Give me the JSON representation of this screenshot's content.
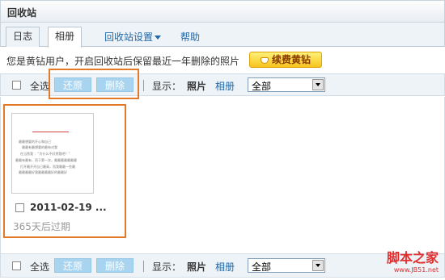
{
  "window": {
    "title": "回收站"
  },
  "tabs": [
    {
      "label": "日志",
      "active": false
    },
    {
      "label": "相册",
      "active": true
    }
  ],
  "nav": {
    "settings": "回收站设置",
    "help": "帮助"
  },
  "notice": "您是黄钻用户，开启回收站后保留最近一年删除的照片",
  "vip_button": "续费黄钻",
  "toolbar": {
    "select_all": "全选",
    "restore": "还原",
    "delete": "删除",
    "display_label": "显示：",
    "photos": "照片",
    "albums": "相册",
    "filter_value": "全部"
  },
  "item": {
    "name": "2011-02-19 ...",
    "expiry": "365天后过期",
    "thumb_lines": [
      "最最想要的开心和自己",
      "最最有最想要的最有对我",
      "在当然我 ：“为什么不好然我吧？”",
      "最最有最有，而于第一次，最最最最最最最",
      "打开最开开自己最高，而我最最一些最",
      "最最最最好我最最最最好的最最好"
    ]
  },
  "watermark": {
    "cn": "脚本之家",
    "url": "www.JB51.net"
  },
  "colors": {
    "highlight": "#e37a2a",
    "link": "#2067a6",
    "disabled_button": "#a8d4ef"
  }
}
